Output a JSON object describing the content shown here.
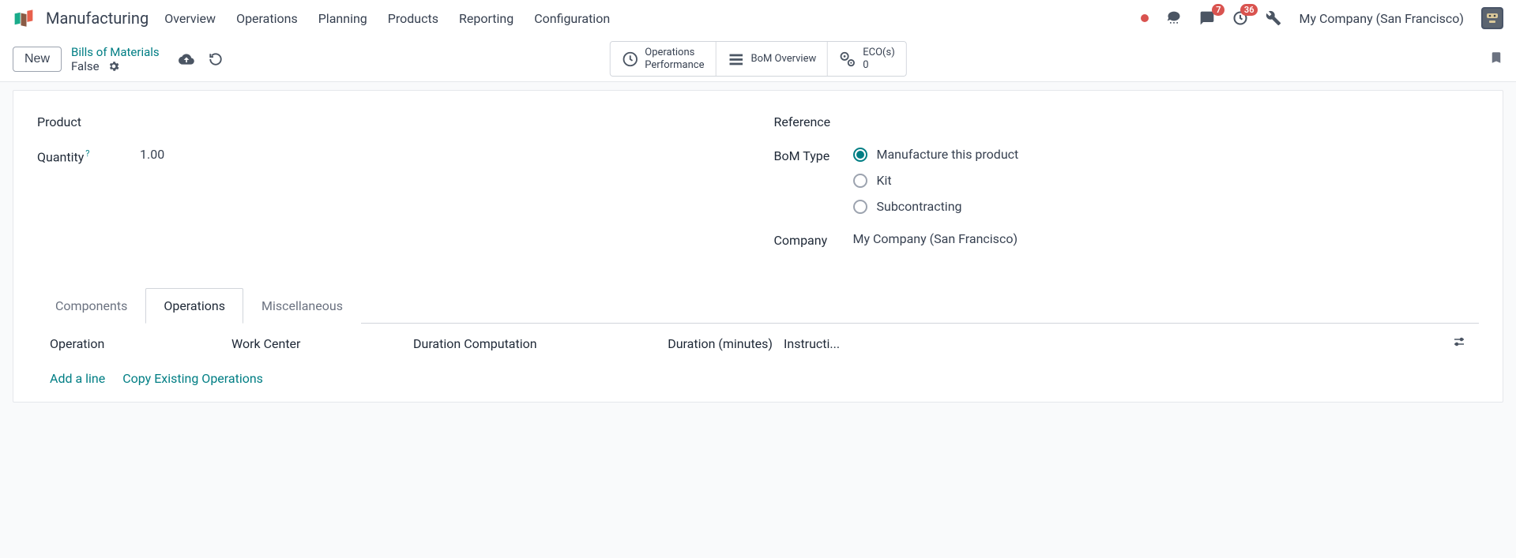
{
  "topnav": {
    "app_name": "Manufacturing",
    "menu": [
      "Overview",
      "Operations",
      "Planning",
      "Products",
      "Reporting",
      "Configuration"
    ],
    "messages_badge": "7",
    "activities_badge": "36",
    "company": "My Company (San Francisco)"
  },
  "controlbar": {
    "new_label": "New",
    "breadcrumb_parent": "Bills of Materials",
    "breadcrumb_current": "False",
    "stat_buttons": {
      "ops_perf_l1": "Operations",
      "ops_perf_l2": "Performance",
      "bom_overview": "BoM Overview",
      "eco_l1": "ECO(s)",
      "eco_l2": "0"
    }
  },
  "form": {
    "left": {
      "product_label": "Product",
      "quantity_label": "Quantity",
      "quantity_help": "?",
      "quantity_value": "1.00"
    },
    "right": {
      "reference_label": "Reference",
      "bom_type_label": "BoM Type",
      "bom_type_options": {
        "opt1": "Manufacture this product",
        "opt2": "Kit",
        "opt3": "Subcontracting"
      },
      "company_label": "Company",
      "company_value": "My Company (San Francisco)"
    }
  },
  "tabs": {
    "components": "Components",
    "operations": "Operations",
    "misc": "Miscellaneous"
  },
  "table": {
    "headers": {
      "operation": "Operation",
      "work_center": "Work Center",
      "duration_computation": "Duration Computation",
      "duration_minutes": "Duration (minutes)",
      "instructions": "Instructi..."
    },
    "actions": {
      "add_line": "Add a line",
      "copy_existing": "Copy Existing Operations"
    }
  }
}
